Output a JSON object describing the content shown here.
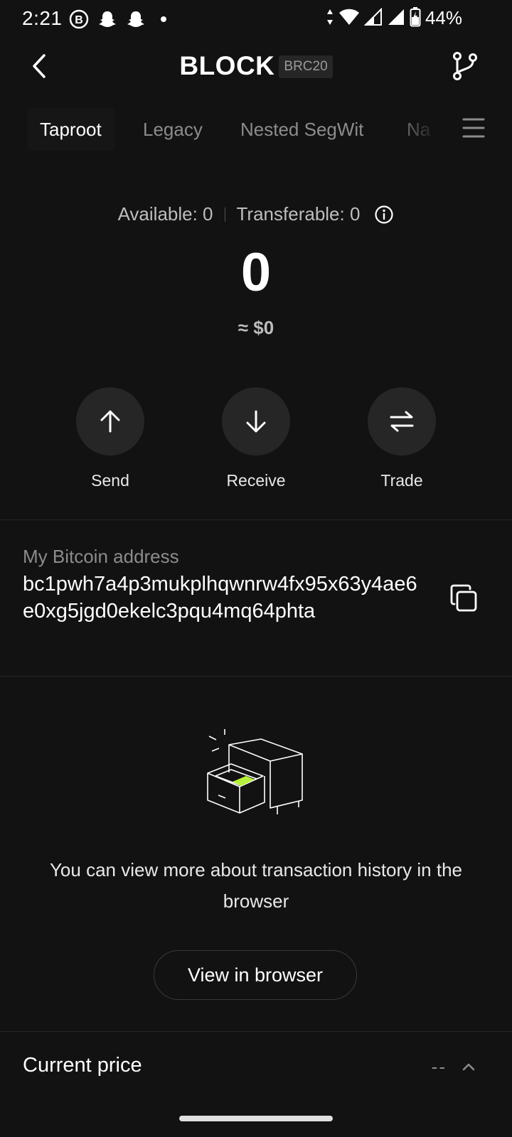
{
  "status_bar": {
    "time": "2:21",
    "battery_percent": "44%",
    "icons": [
      "b-icon",
      "snapchat-icon",
      "snapchat-icon",
      "dot-icon",
      "data-arrows-icon",
      "wifi-icon",
      "signal-icon",
      "signal-icon",
      "battery-charging-icon"
    ]
  },
  "header": {
    "title": "BLOCK",
    "badge": "BRC20"
  },
  "tabs": [
    {
      "label": "Taproot",
      "active": true
    },
    {
      "label": "Legacy",
      "active": false
    },
    {
      "label": "Nested SegWit",
      "active": false
    },
    {
      "label": "Na",
      "active": false
    }
  ],
  "balance": {
    "available": "Available: 0",
    "transferable": "Transferable: 0",
    "amount": "0",
    "fiat": "≈ $0"
  },
  "actions": [
    {
      "label": "Send",
      "icon": "arrow-up-icon"
    },
    {
      "label": "Receive",
      "icon": "arrow-down-icon"
    },
    {
      "label": "Trade",
      "icon": "swap-icon"
    }
  ],
  "address": {
    "label": "My Bitcoin address",
    "value": "bc1pwh7a4p3mukplhqwnrw4fx95x63y4ae6e0xg5jgd0ekelc3pqu4mq64phta"
  },
  "empty_state": {
    "message": "You can view more about transaction history in the browser",
    "button": "View in browser"
  },
  "price": {
    "label": "Current price",
    "value": "--"
  },
  "colors": {
    "background": "#121212",
    "surface": "#262626",
    "text_secondary": "#8c8c8c",
    "accent": "#b6f03c"
  }
}
